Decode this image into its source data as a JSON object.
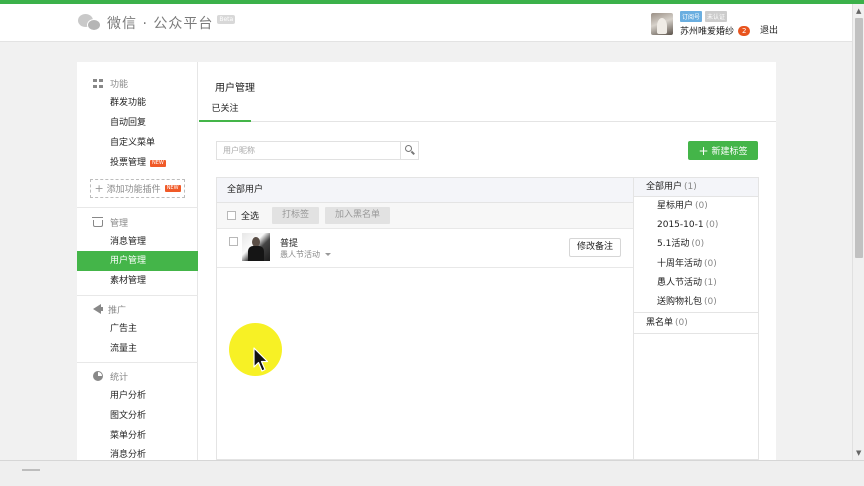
{
  "header": {
    "logo_text": "微信 · 公众平台",
    "logo_badge": "Beta",
    "account": {
      "tag_subscription": "订阅号",
      "tag_unverified": "未认证",
      "name": "苏州唯爱婚纱",
      "notice_count": "2"
    },
    "logout_label": "退出"
  },
  "sidebar": {
    "sections": [
      {
        "title": "功能",
        "icon": "grid-icon",
        "items": [
          {
            "label": "群发功能"
          },
          {
            "label": "自动回复"
          },
          {
            "label": "自定义菜单"
          },
          {
            "label": "投票管理",
            "badge": "NEW"
          }
        ],
        "plugin_button": "添加功能插件",
        "plugin_badge": "NEW"
      },
      {
        "title": "管理",
        "icon": "tray-icon",
        "items": [
          {
            "label": "消息管理"
          },
          {
            "label": "用户管理",
            "active": true
          },
          {
            "label": "素材管理"
          }
        ]
      },
      {
        "title": "推广",
        "icon": "megaphone-icon",
        "items": [
          {
            "label": "广告主"
          },
          {
            "label": "流量主"
          }
        ]
      },
      {
        "title": "统计",
        "icon": "pie-chart-icon",
        "items": [
          {
            "label": "用户分析"
          },
          {
            "label": "图文分析"
          },
          {
            "label": "菜单分析"
          },
          {
            "label": "消息分析"
          }
        ]
      }
    ]
  },
  "main": {
    "title": "用户管理",
    "tabs": [
      {
        "label": "已关注",
        "active": true
      }
    ],
    "search": {
      "placeholder": "用户昵称"
    },
    "new_tag_button": "新建标签",
    "list": {
      "header": "全部用户",
      "select_all_label": "全选",
      "tag_button": "打标签",
      "blacklist_button": "加入黑名单",
      "users": [
        {
          "nickname": "普提",
          "tag": "愚人节活动",
          "remark_button": "修改备注"
        }
      ]
    },
    "tag_panel": {
      "all_users": {
        "label": "全部用户",
        "count": "(1)"
      },
      "tags": [
        {
          "label": "星标用户",
          "count": "(0)"
        },
        {
          "label": "2015-10-1",
          "count": "(0)"
        },
        {
          "label": "5.1活动",
          "count": "(0)"
        },
        {
          "label": "十周年活动",
          "count": "(0)"
        },
        {
          "label": "愚人节活动",
          "count": "(1)"
        },
        {
          "label": "送购物礼包",
          "count": "(0)"
        }
      ],
      "blacklist": {
        "label": "黑名单",
        "count": "(0)"
      }
    }
  },
  "colors": {
    "brand_green": "#44b549",
    "notice_red": "#e8541e",
    "cursor_highlight": "#f6f012"
  }
}
